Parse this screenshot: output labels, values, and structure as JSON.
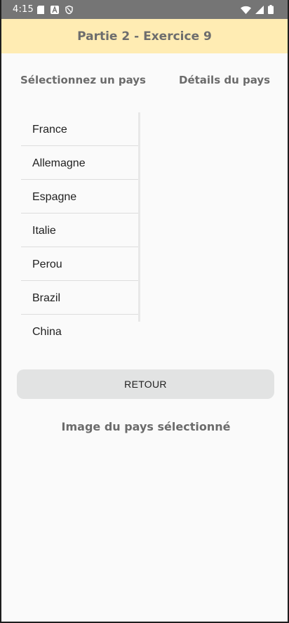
{
  "statusbar": {
    "time": "4:15",
    "left_icons": [
      "sd-card-icon",
      "a-letter-icon",
      "shield-icon"
    ],
    "right_icons": [
      "wifi-icon",
      "signal-icon",
      "battery-icon"
    ]
  },
  "appbar": {
    "title": "Partie 2 - Exercice 9"
  },
  "headers": {
    "select_label": "Sélectionnez un pays",
    "details_label": "Détails du pays"
  },
  "countries": [
    "France",
    "Allemagne",
    "Espagne",
    "Italie",
    "Perou",
    "Brazil",
    "China"
  ],
  "buttons": {
    "retour": "RETOUR"
  },
  "image_label": "Image du pays sélectionné",
  "colors": {
    "appbar_bg": "#ffecb3",
    "statusbar_bg": "#757575",
    "button_bg": "#e2e3e3",
    "page_bg": "#fafafa"
  }
}
